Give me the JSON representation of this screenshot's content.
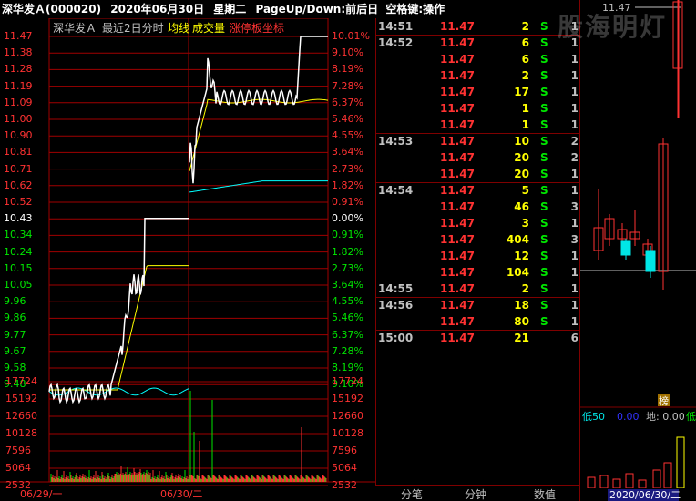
{
  "title": {
    "name": "深华发Ａ(000020)",
    "date": "2020年06月30日",
    "weekday": "星期二",
    "hint": "PageUp/Down:前后日",
    "hint2": "空格键:操作"
  },
  "chart_header": {
    "stock": "深华发Ａ",
    "range": "最近2日分时",
    "avg": "均线",
    "vol": "成交量",
    "limit": "涨停板坐标"
  },
  "price_ticks": [
    "11.47",
    "11.38",
    "11.28",
    "11.19",
    "11.09",
    "11.00",
    "10.90",
    "10.81",
    "10.71",
    "10.62",
    "10.52",
    "10.43",
    "10.34",
    "10.24",
    "10.15",
    "10.05",
    "9.96",
    "9.86",
    "9.77",
    "9.67",
    "9.58",
    "9.48"
  ],
  "pct_ticks": [
    "10.01%",
    "9.10%",
    "8.19%",
    "7.28%",
    "6.37%",
    "5.46%",
    "4.55%",
    "3.64%",
    "2.73%",
    "1.82%",
    "0.91%",
    "0.00%",
    "0.91%",
    "1.82%",
    "2.73%",
    "3.64%",
    "4.55%",
    "5.46%",
    "6.37%",
    "7.28%",
    "8.19%",
    "9.10%"
  ],
  "vol_ticks_left": [
    "17724",
    "15192",
    "12660",
    "10128",
    "7596",
    "5064",
    "2532"
  ],
  "vol_ticks_right": [
    "17724",
    "15192",
    "12660",
    "10128",
    "7596",
    "5064",
    "2532"
  ],
  "date_labels": [
    "06/29/一",
    "06/30/二"
  ],
  "colors": {
    "up": "#ff3232",
    "down": "#00e600",
    "price": "#ffffff",
    "avg": "#ffff00",
    "prevavg": "#00ffff",
    "grid": "#a00000",
    "vol": "#ffffff"
  },
  "ticks": [
    {
      "time": "14:51",
      "price": "11.47",
      "vol": "2",
      "side": "S",
      "n": "1"
    },
    {
      "time": "14:52",
      "price": "11.47",
      "vol": "6",
      "side": "S",
      "n": "1"
    },
    {
      "time": "",
      "price": "11.47",
      "vol": "6",
      "side": "S",
      "n": "1"
    },
    {
      "time": "",
      "price": "11.47",
      "vol": "2",
      "side": "S",
      "n": "1"
    },
    {
      "time": "",
      "price": "11.47",
      "vol": "17",
      "side": "S",
      "n": "1"
    },
    {
      "time": "",
      "price": "11.47",
      "vol": "1",
      "side": "S",
      "n": "1"
    },
    {
      "time": "",
      "price": "11.47",
      "vol": "1",
      "side": "S",
      "n": "1"
    },
    {
      "time": "14:53",
      "price": "11.47",
      "vol": "10",
      "side": "S",
      "n": "2"
    },
    {
      "time": "",
      "price": "11.47",
      "vol": "20",
      "side": "S",
      "n": "2"
    },
    {
      "time": "",
      "price": "11.47",
      "vol": "20",
      "side": "S",
      "n": "1"
    },
    {
      "time": "14:54",
      "price": "11.47",
      "vol": "5",
      "side": "S",
      "n": "1"
    },
    {
      "time": "",
      "price": "11.47",
      "vol": "46",
      "side": "S",
      "n": "3"
    },
    {
      "time": "",
      "price": "11.47",
      "vol": "3",
      "side": "S",
      "n": "1"
    },
    {
      "time": "",
      "price": "11.47",
      "vol": "404",
      "side": "S",
      "n": "3"
    },
    {
      "time": "",
      "price": "11.47",
      "vol": "12",
      "side": "S",
      "n": "1"
    },
    {
      "time": "",
      "price": "11.47",
      "vol": "104",
      "side": "S",
      "n": "1"
    },
    {
      "time": "14:55",
      "price": "11.47",
      "vol": "2",
      "side": "S",
      "n": "1"
    },
    {
      "time": "14:56",
      "price": "11.47",
      "vol": "18",
      "side": "S",
      "n": "1"
    },
    {
      "time": "",
      "price": "11.47",
      "vol": "80",
      "side": "S",
      "n": "1"
    },
    {
      "time": "15:00",
      "price": "11.47",
      "vol": "21",
      "side": "",
      "n": "6"
    }
  ],
  "tabs": [
    "分笔",
    "分钟",
    "数值"
  ],
  "kline": {
    "top_price": "11.47",
    "bang": "榜",
    "indicator": "低50",
    "ind_val1": "0.00",
    "ind_val2": "地: 0.00",
    "ind_val3": "低",
    "date": "2020/06/30/二"
  },
  "watermark": "股海明灯"
}
